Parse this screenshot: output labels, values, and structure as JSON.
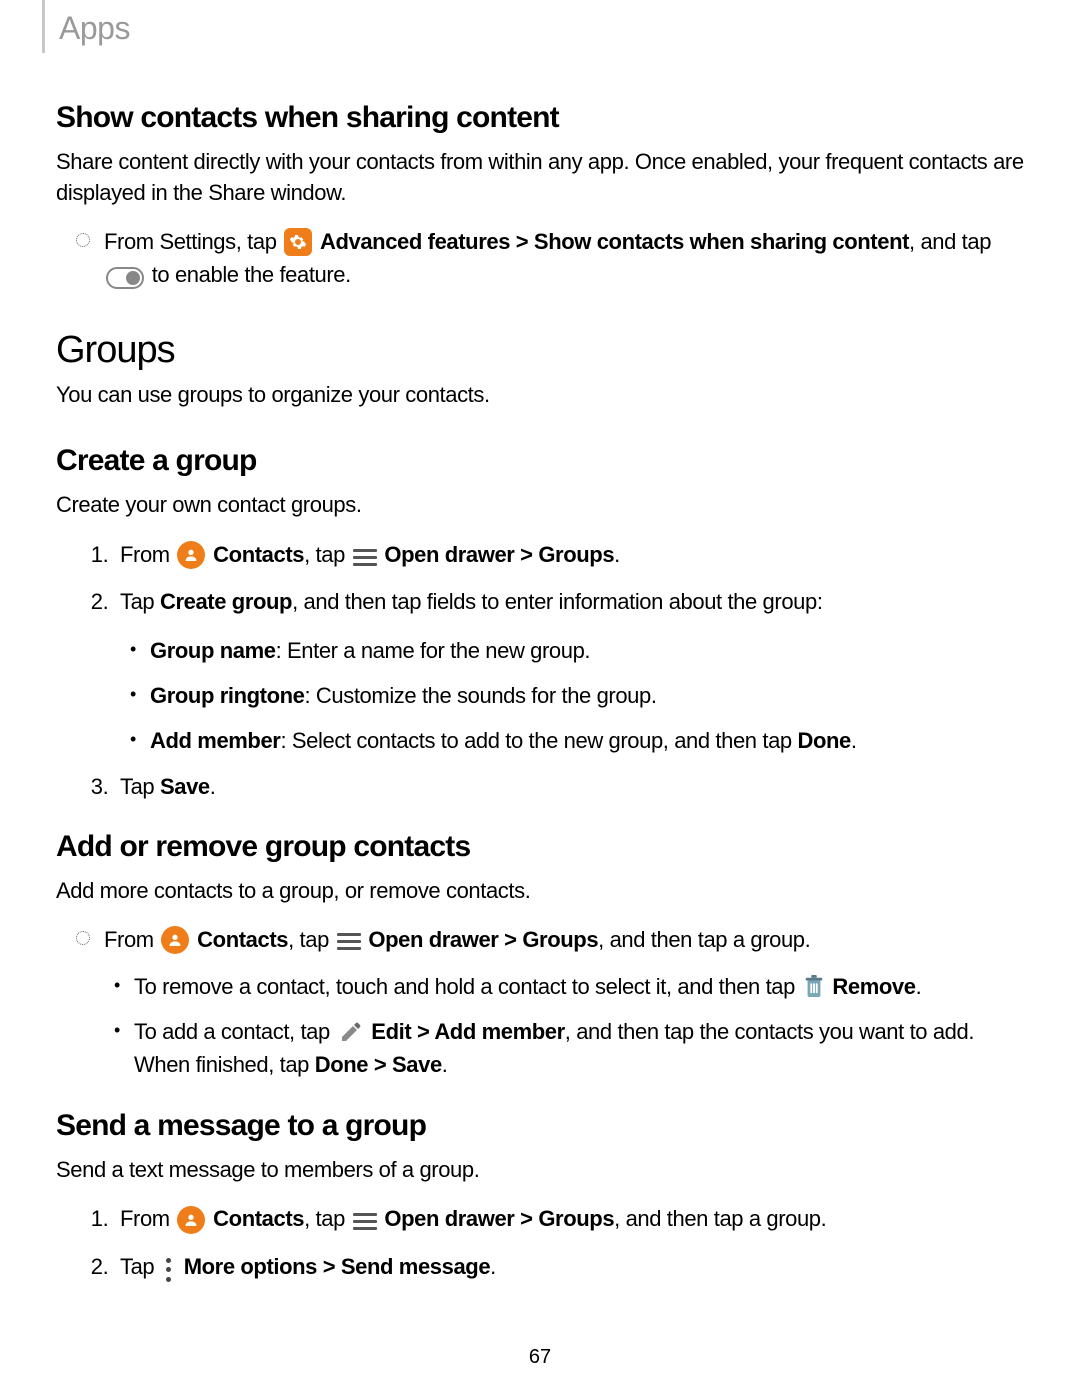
{
  "breadcrumb": "Apps",
  "page_number": "67",
  "sec1": {
    "title": "Show contacts when sharing content",
    "intro": "Share content directly with your contacts from within any app. Once enabled, your frequent contacts are displayed in the Share window.",
    "step_pre": "From Settings, tap ",
    "adv_features": "Advanced features",
    "gt1": " > ",
    "show_contacts": "Show contacts when sharing content",
    "and_tap": ", and tap ",
    "to_enable": " to enable the feature."
  },
  "sec2": {
    "title": "Groups",
    "intro": "You can use groups to organize your contacts."
  },
  "sec3": {
    "title": "Create a group",
    "intro": "Create your own contact groups.",
    "s1_pre": "From ",
    "contacts": "Contacts",
    "s1_tap": ", tap ",
    "open_drawer": "Open drawer",
    "gt": " > ",
    "groups": "Groups",
    "period": ".",
    "s2_pre": "Tap ",
    "create_group": "Create group",
    "s2_post": ", and then tap fields to enter information about the group:",
    "b1_label": "Group name",
    "b1_text": ": Enter a name for the new group.",
    "b2_label": "Group ringtone",
    "b2_text": ": Customize the sounds for the group.",
    "b3_label": "Add member",
    "b3_text": ": Select contacts to add to the new group, and then tap ",
    "done": "Done",
    "s3_pre": "Tap ",
    "save": "Save"
  },
  "sec4": {
    "title": "Add or remove group contacts",
    "intro": "Add more contacts to a group, or remove contacts.",
    "s1_pre": "From ",
    "contacts": "Contacts",
    "s1_tap": ", tap ",
    "open_drawer": "Open drawer",
    "gt": " > ",
    "groups": "Groups",
    "s1_post": ", and then tap a group.",
    "b1_pre": "To remove a contact, touch and hold a contact to select it, and then tap ",
    "remove": "Remove",
    "period": ".",
    "b2_pre": "To add a contact, tap ",
    "edit": "Edit",
    "add_member": "Add member",
    "b2_mid": ", and then tap the contacts you want to add. When finished, tap ",
    "done": "Done",
    "save": "Save"
  },
  "sec5": {
    "title": "Send a message to a group",
    "intro": "Send a text message to members of a group.",
    "s1_pre": "From ",
    "contacts": "Contacts",
    "s1_tap": ", tap ",
    "open_drawer": "Open drawer",
    "gt": " > ",
    "groups": "Groups",
    "s1_post": ", and then tap a group.",
    "s2_pre": "Tap ",
    "more_options": "More options",
    "send_message": "Send message",
    "period": "."
  }
}
